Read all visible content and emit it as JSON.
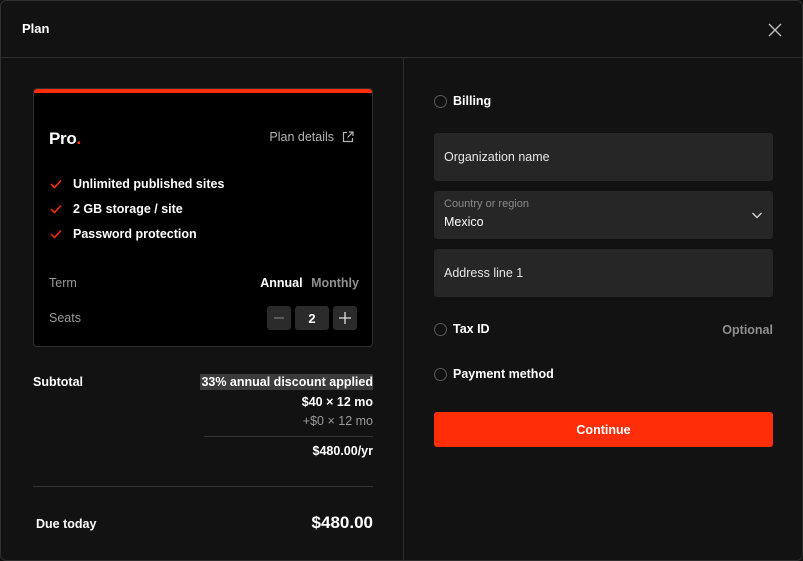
{
  "header": {
    "title": "Plan"
  },
  "plan": {
    "name": "Pro",
    "name_dot": ".",
    "details_link": "Plan details",
    "features": [
      "Unlimited published sites",
      "2 GB storage / site",
      "Password protection"
    ],
    "term_label": "Term",
    "term_options": [
      "Annual",
      "Monthly"
    ],
    "term_selected": "Annual",
    "seats_label": "Seats",
    "seats_value": "2",
    "accent_color": "#ff2e08"
  },
  "summary": {
    "subtotal_label": "Subtotal",
    "discount": "33% annual discount applied",
    "price_line": "$40 × 12 mo",
    "price_extra": "+$0 × 12 mo",
    "annual_total": "$480.00/yr",
    "due_label": "Due today",
    "due_amount": "$480.00"
  },
  "form": {
    "billing_label": "Billing",
    "org_placeholder": "Organization name",
    "country_caption": "Country or region",
    "country_value": "Mexico",
    "address_placeholder": "Address line 1",
    "taxid_label": "Tax ID",
    "taxid_optional": "Optional",
    "payment_label": "Payment method",
    "continue_label": "Continue"
  },
  "icons": {
    "close": "close-icon",
    "external_link": "external-link-icon",
    "check": "check-icon",
    "minus": "minus-icon",
    "plus": "plus-icon",
    "chevron": "chevron-down-icon"
  }
}
